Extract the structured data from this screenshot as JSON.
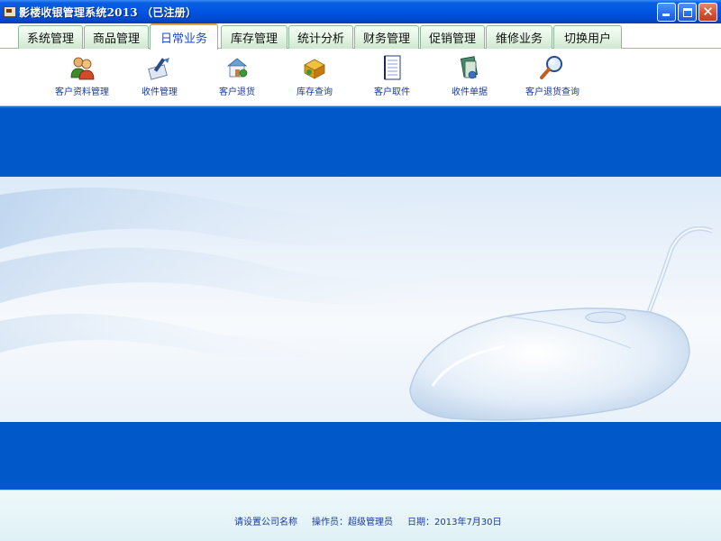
{
  "window": {
    "title": "影楼收银管理系统2013 （已注册）",
    "accent_color": "#0054e3",
    "controls": [
      "minimize-icon",
      "maximize-icon",
      "close-icon"
    ]
  },
  "tabs": [
    {
      "label": "系统管理",
      "active": false
    },
    {
      "label": "商品管理",
      "active": false
    },
    {
      "label": "日常业务",
      "active": true
    },
    {
      "label": "库存管理",
      "active": false
    },
    {
      "label": "统计分析",
      "active": false
    },
    {
      "label": "财务管理",
      "active": false
    },
    {
      "label": "促销管理",
      "active": false
    },
    {
      "label": "维修业务",
      "active": false
    },
    {
      "label": "切换用户",
      "active": false
    }
  ],
  "toolbar": {
    "items": [
      {
        "label": "客户资料管理",
        "icon": "users-icon"
      },
      {
        "label": "收件管理",
        "icon": "receive-icon"
      },
      {
        "label": "客户退货",
        "icon": "return-icon"
      },
      {
        "label": "库存查询",
        "icon": "inventory-icon"
      },
      {
        "label": "客户取件",
        "icon": "notebook-icon"
      },
      {
        "label": "收件单据",
        "icon": "receipt-icon"
      },
      {
        "label": "客户退货查询",
        "icon": "search-icon"
      }
    ]
  },
  "status": {
    "company": "请设置公司名称",
    "operator": "操作员：超级管理员",
    "date": "日期：2013年7月30日"
  },
  "colors": {
    "band": "#0158c8",
    "tab_active_text": "#1b4db8",
    "toolbar_text": "#1a3a9a",
    "status_bg": "#e6f4f8"
  }
}
